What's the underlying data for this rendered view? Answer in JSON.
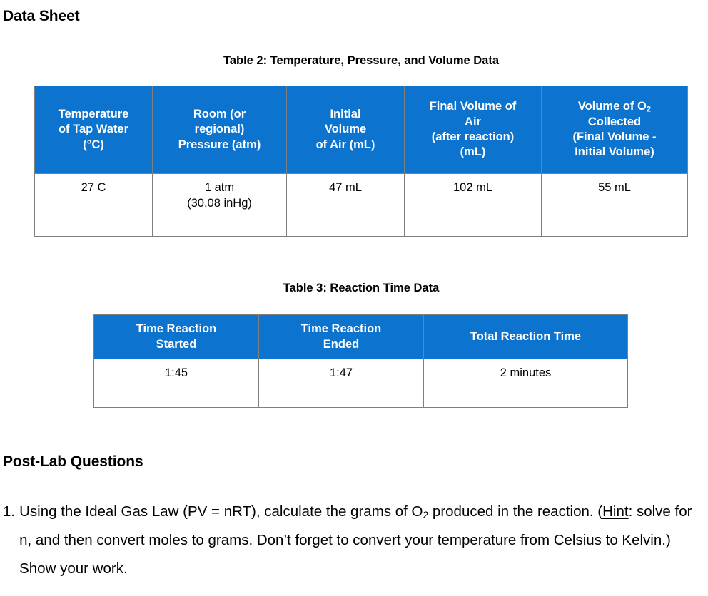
{
  "document": {
    "data_sheet_heading": "Data Sheet",
    "postlab_heading": "Post-Lab Questions"
  },
  "table2": {
    "caption": "Table 2: Temperature, Pressure, and Volume Data",
    "headers": [
      "Temperature\nof Tap Water\n(°C)",
      "Room (or\nregional)\nPressure (atm)",
      "Initial\nVolume\nof Air (mL)",
      "Final Volume of\nAir\n(after reaction)\n(mL)",
      "Volume of O2\nCollected\n(Final Volume -\nInitial Volume)"
    ],
    "header_parts": {
      "col1_line1": "Temperature",
      "col1_line2": "of Tap Water",
      "col1_line3": "(°C)",
      "col2_line1": "Room (or",
      "col2_line2": "regional)",
      "col2_line3": "Pressure (atm)",
      "col3_line1": "Initial",
      "col3_line2": "Volume",
      "col3_line3": "of Air (mL)",
      "col4_line1": "Final Volume of",
      "col4_line2": "Air",
      "col4_line3": "(after reaction)",
      "col4_line4": "(mL)",
      "col5_line1_pre": "Volume of O",
      "col5_line1_sub": "2",
      "col5_line2": "Collected",
      "col5_line3": "(Final Volume -",
      "col5_line4": "Initial Volume)"
    },
    "row": {
      "temperature": "27 C",
      "pressure_line1": "1 atm",
      "pressure_line2": "(30.08 inHg)",
      "initial_volume": "47 mL",
      "final_volume": "102 mL",
      "oxygen_volume": "55 mL"
    }
  },
  "table3": {
    "caption": "Table 3: Reaction Time Data",
    "header_parts": {
      "col1_line1": "Time Reaction",
      "col1_line2": "Started",
      "col2_line1": "Time Reaction",
      "col2_line2": "Ended",
      "col3_line1": "Total Reaction Time"
    },
    "row": {
      "time_started": "1:45",
      "time_ended": "1:47",
      "total_time": "2 minutes"
    }
  },
  "questions": [
    {
      "number": "1.",
      "text_part1": "Using the Ideal Gas Law (PV = nRT), calculate the grams of O",
      "text_sub": "2",
      "text_part2": " produced in the reaction. (",
      "hint_label": "Hint",
      "text_part3": ": solve for n, and then convert moles to grams. Don’t forget to convert your temperature from Celsius to Kelvin.) Show your work."
    }
  ],
  "colors": {
    "header_blue": "#0c73cf",
    "border_gray": "#7f7f7f",
    "text_black": "#000000",
    "header_text": "#ffffff"
  }
}
